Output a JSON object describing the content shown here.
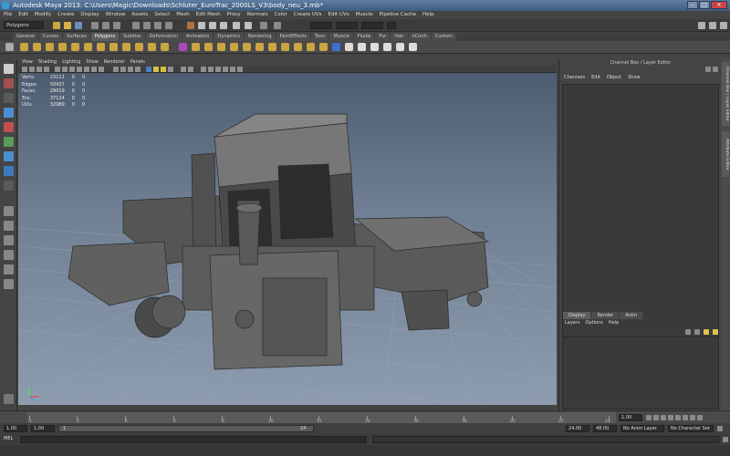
{
  "title": "Autodesk Maya 2013: C:\\Users\\Magic\\Downloads\\Schluter_EuroTrac_2000LS_V3\\body_neu_3.mb*",
  "menubar": [
    "File",
    "Edit",
    "Modify",
    "Create",
    "Display",
    "Window",
    "Assets",
    "Select",
    "Mesh",
    "Edit Mesh",
    "Proxy",
    "Normals",
    "Color",
    "Create UVs",
    "Edit UVs",
    "Muscle",
    "Pipeline Cache",
    "Help"
  ],
  "mode": "Polygons",
  "shelf_tabs": [
    {
      "label": "General",
      "active": false
    },
    {
      "label": "Curves",
      "active": false
    },
    {
      "label": "Surfaces",
      "active": false
    },
    {
      "label": "Polygons",
      "active": true
    },
    {
      "label": "Subdivs",
      "active": false
    },
    {
      "label": "Deformation",
      "active": false
    },
    {
      "label": "Animation",
      "active": false
    },
    {
      "label": "Dynamics",
      "active": false
    },
    {
      "label": "Rendering",
      "active": false
    },
    {
      "label": "PaintEffects",
      "active": false
    },
    {
      "label": "Toon",
      "active": false
    },
    {
      "label": "Muscle",
      "active": false
    },
    {
      "label": "Fluids",
      "active": false
    },
    {
      "label": "Fur",
      "active": false
    },
    {
      "label": "Hair",
      "active": false
    },
    {
      "label": "nCloth",
      "active": false
    },
    {
      "label": "Custom",
      "active": false
    }
  ],
  "panel_menu": [
    "View",
    "Shading",
    "Lighting",
    "Show",
    "Renderer",
    "Panels"
  ],
  "hud": [
    {
      "label": "Verts:",
      "v1": "23111",
      "v2": "0",
      "v3": "0"
    },
    {
      "label": "Edges:",
      "v1": "50437",
      "v2": "0",
      "v3": "0"
    },
    {
      "label": "Faces:",
      "v1": "29019",
      "v2": "0",
      "v3": "0"
    },
    {
      "label": "Tris:",
      "v1": "37124",
      "v2": "0",
      "v3": "0"
    },
    {
      "label": "UVs:",
      "v1": "32989",
      "v2": "0",
      "v3": "0"
    }
  ],
  "channel_box": {
    "header": "Channel Box / Layer Editor",
    "menu": [
      "Channels",
      "Edit",
      "Object",
      "Show"
    ]
  },
  "layer_editor": {
    "tabs": [
      {
        "label": "Display",
        "active": true
      },
      {
        "label": "Render",
        "active": false
      },
      {
        "label": "Anim",
        "active": false
      }
    ],
    "menu": [
      "Layers",
      "Options",
      "Help"
    ]
  },
  "vertical_tabs": [
    "Channel Box / Layer Editor",
    "Attribute Editor"
  ],
  "time_slider": {
    "ticks": [
      "1",
      "2",
      "4",
      "6",
      "8",
      "10",
      "12",
      "14",
      "16",
      "18",
      "20",
      "22",
      "24"
    ],
    "current": "1.00"
  },
  "range": {
    "start": "1.00",
    "start2": "1.00",
    "range_in": "1",
    "range_out": "24",
    "end": "24.00",
    "end2": "48.00",
    "anim_layer": "No Anim Layer",
    "char_set": "No Character Set"
  },
  "command_line": {
    "lang": "MEL"
  },
  "colors": {
    "viewport_top": "#4d5c70",
    "viewport_bottom": "#8d9cae",
    "title_bar": "#3d5a7f",
    "accent": "#c9a642"
  }
}
